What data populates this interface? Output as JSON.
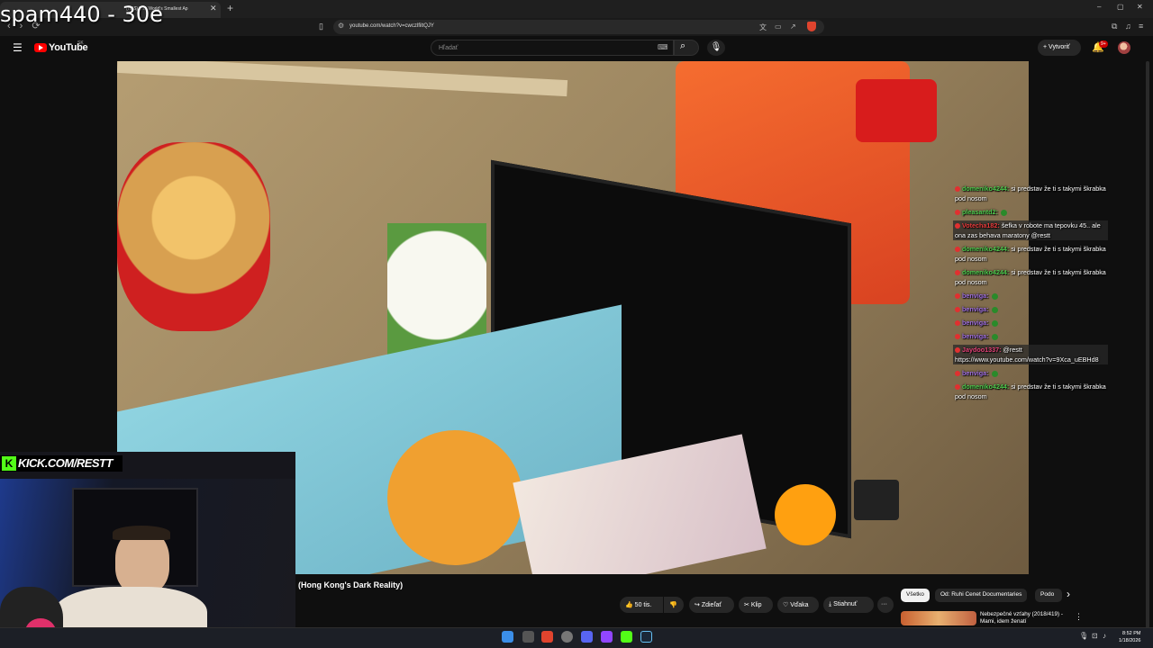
{
  "overlay": {
    "title": "spam440 - 30e"
  },
  "browser": {
    "tab_title": "(HK$) The World's Smallest Ap",
    "url": "youtube.com/watch?v=cwczlfiltQJY",
    "window_controls": [
      "–",
      "▢",
      "✕"
    ]
  },
  "youtube": {
    "logo_text": "YouTube",
    "country_code": "SK",
    "search_placeholder": "Hľadať",
    "create_label": "Vytvoriť",
    "notifications": "9+"
  },
  "chat": {
    "messages": [
      {
        "user": "domeniko4244:",
        "text": "si predstav že ti s takymi škrabka pod nosom",
        "color": "#4ecb4e",
        "highlight": false
      },
      {
        "user": "pleasantd2:",
        "text": "",
        "color": "#4ecb4e",
        "highlight": false,
        "emote": true
      },
      {
        "user": "Votecha182:",
        "text": "šefka v robote ma tepovku 45.. ale ona zas behava maratony @restt",
        "color": "#e83c3c",
        "highlight": true
      },
      {
        "user": "domeniko4244:",
        "text": "si predstav že ti s takymi škrabka pod nosom",
        "color": "#4ecb4e",
        "highlight": false
      },
      {
        "user": "domeniko4244:",
        "text": "si predstav že ti s takymi škrabka pod nosom",
        "color": "#4ecb4e",
        "highlight": false
      },
      {
        "user": "benviga:",
        "text": "",
        "color": "#a070e0",
        "highlight": false,
        "emote": true
      },
      {
        "user": "benviga:",
        "text": "",
        "color": "#a070e0",
        "highlight": false,
        "emote": true
      },
      {
        "user": "benviga:",
        "text": "",
        "color": "#a070e0",
        "highlight": false,
        "emote": true
      },
      {
        "user": "benviga:",
        "text": "",
        "color": "#a070e0",
        "highlight": false,
        "emote": true
      },
      {
        "user": "Jaydoo1337:",
        "text": "@restt https://www.youtube.com/watch?v=9Xca_uEBHd8",
        "color": "#e8437a",
        "highlight": true
      },
      {
        "user": "benviga:",
        "text": "",
        "color": "#a070e0",
        "highlight": false,
        "emote": true
      },
      {
        "user": "domeniko4244:",
        "text": "si predstav že ti s takymi škrabka pod nosom",
        "color": "#4ecb4e",
        "highlight": false
      }
    ]
  },
  "stream": {
    "kick_label": "KICK.COM/RESTT"
  },
  "video": {
    "title": "(Hong Kong's Dark Reality)",
    "actions": {
      "like": "50 tis.",
      "share": "Zdieľať",
      "clip": "Klip",
      "thanks": "Vďaka",
      "download": "Stiahnuť",
      "more": "···"
    }
  },
  "filters": {
    "chips": [
      "Všetko",
      "Od: Ruhi Cenet Documentaries",
      "Podo"
    ],
    "next": "›"
  },
  "recommendation": {
    "title": "Nebezpečné vzťahy (2018/419) - Mami, idem ženatí",
    "more": "⋮"
  },
  "taskbar": {
    "time": "8:52 PM",
    "date": "1/18/2026"
  }
}
